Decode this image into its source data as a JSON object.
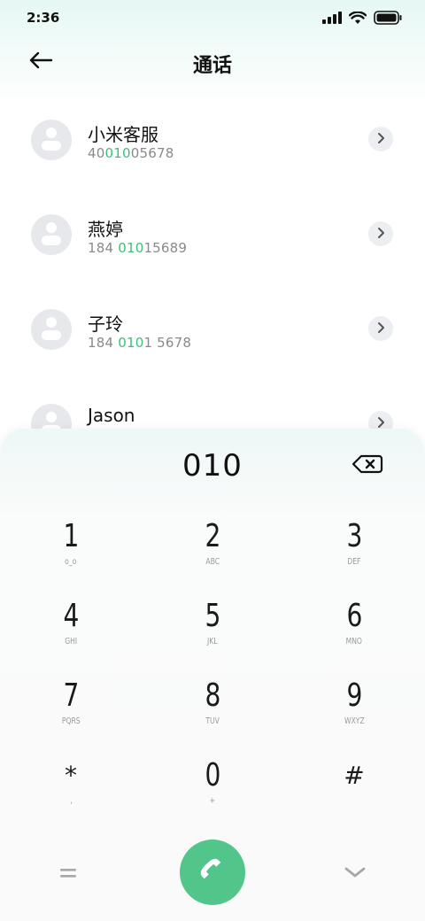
{
  "status_bar": {
    "time": "2:36"
  },
  "header": {
    "title": "通话"
  },
  "contacts": [
    {
      "name": "小米客服",
      "number_pre": "40",
      "number_match": "010",
      "number_post": "05678"
    },
    {
      "name": "燕婷",
      "number_pre": "184 ",
      "number_match": "010",
      "number_post": "15689"
    },
    {
      "name": "子玲",
      "number_pre": "184 ",
      "number_match": "010",
      "number_post": "1 5678"
    },
    {
      "name": "Jason",
      "number_pre": "",
      "number_match": "",
      "number_post": ""
    }
  ],
  "dialpad": {
    "display": "010",
    "keys": [
      {
        "digit": "1",
        "letters": "o_o"
      },
      {
        "digit": "2",
        "letters": "ABC"
      },
      {
        "digit": "3",
        "letters": "DEF"
      },
      {
        "digit": "4",
        "letters": "GHI"
      },
      {
        "digit": "5",
        "letters": "JKL"
      },
      {
        "digit": "6",
        "letters": "MNO"
      },
      {
        "digit": "7",
        "letters": "PQRS"
      },
      {
        "digit": "8",
        "letters": "TUV"
      },
      {
        "digit": "9",
        "letters": "WXYZ"
      },
      {
        "digit": "*",
        "letters": ","
      },
      {
        "digit": "0",
        "letters": "+"
      },
      {
        "digit": "#",
        "letters": ""
      }
    ]
  },
  "colors": {
    "accent": "#3cc07a",
    "call_button": "#52c58a"
  },
  "icons": {
    "back": "arrow-left-icon",
    "backspace": "backspace-icon",
    "menu": "menu-icon",
    "call": "phone-icon",
    "collapse": "chevron-down-icon"
  }
}
